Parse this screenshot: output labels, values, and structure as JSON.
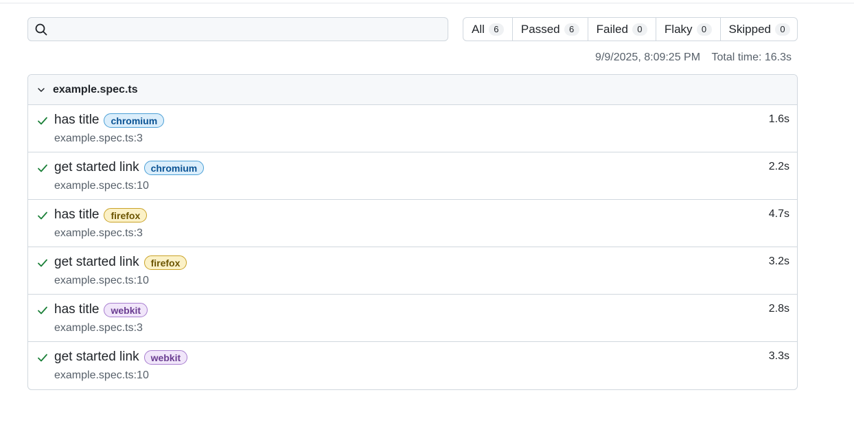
{
  "search": {
    "value": "",
    "placeholder": ""
  },
  "filters": [
    {
      "label": "All",
      "count": "6"
    },
    {
      "label": "Passed",
      "count": "6"
    },
    {
      "label": "Failed",
      "count": "0"
    },
    {
      "label": "Flaky",
      "count": "0"
    },
    {
      "label": "Skipped",
      "count": "0"
    }
  ],
  "meta": {
    "timestamp": "9/9/2025, 8:09:25 PM",
    "total_time": "Total time: 16.3s"
  },
  "file": {
    "name": "example.spec.ts",
    "expanded": true,
    "icon": "chevron-down-icon"
  },
  "tests": [
    {
      "title": "has title",
      "project": "chromium",
      "location": "example.spec.ts:3",
      "duration": "1.6s",
      "status": "passed"
    },
    {
      "title": "get started link",
      "project": "chromium",
      "location": "example.spec.ts:10",
      "duration": "2.2s",
      "status": "passed"
    },
    {
      "title": "has title",
      "project": "firefox",
      "location": "example.spec.ts:3",
      "duration": "4.7s",
      "status": "passed"
    },
    {
      "title": "get started link",
      "project": "firefox",
      "location": "example.spec.ts:10",
      "duration": "3.2s",
      "status": "passed"
    },
    {
      "title": "has title",
      "project": "webkit",
      "location": "example.spec.ts:3",
      "duration": "2.8s",
      "status": "passed"
    },
    {
      "title": "get started link",
      "project": "webkit",
      "location": "example.spec.ts:10",
      "duration": "3.3s",
      "status": "passed"
    }
  ],
  "colors": {
    "passed": "#1a7f37",
    "chromium": "#0b5394",
    "firefox": "#6b5400",
    "webkit": "#6a3d91"
  }
}
